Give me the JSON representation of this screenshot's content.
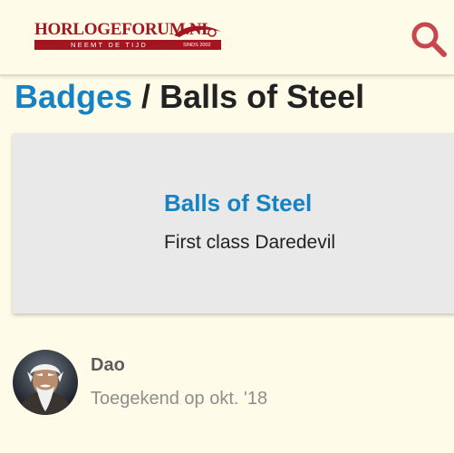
{
  "header": {
    "logo": {
      "title": "HORLOGEFORUM.NL",
      "tagline": "NEEMT DE TIJD",
      "since": "SINDS 2002"
    },
    "search_icon": "search-icon"
  },
  "page": {
    "breadcrumb_link": "Badges",
    "separator": " / ",
    "title": "Balls of Steel"
  },
  "badge": {
    "name": "Balls of Steel",
    "description": "First class Daredevil"
  },
  "grant": {
    "username": "Dao",
    "granted_text": "Toegekend op okt. '18"
  },
  "colors": {
    "background": "#fefbe8",
    "link": "#1583c3",
    "logo_red": "#a3151f",
    "search_icon": "#c6474f",
    "card": "#e9e9e9"
  }
}
